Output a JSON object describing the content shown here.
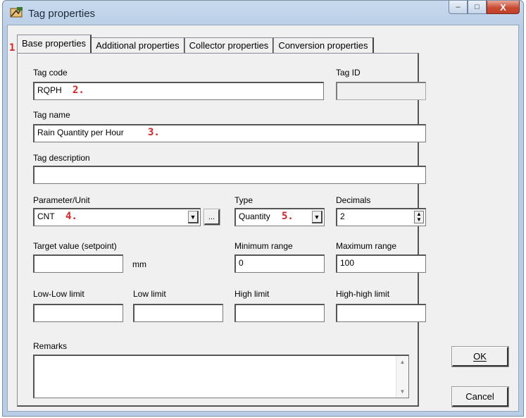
{
  "window": {
    "title": "Tag properties",
    "buttons": {
      "minimize": "–",
      "maximize": "□",
      "close": "X"
    }
  },
  "tabs": [
    {
      "label": "Base properties",
      "active": true
    },
    {
      "label": "Additional properties"
    },
    {
      "label": "Collector properties"
    },
    {
      "label": "Conversion properties"
    }
  ],
  "form": {
    "tag_code": {
      "label": "Tag code",
      "value": "RQPH"
    },
    "tag_id": {
      "label": "Tag ID",
      "value": ""
    },
    "tag_name": {
      "label": "Tag name",
      "value": "Rain Quantity per Hour"
    },
    "tag_description": {
      "label": "Tag description",
      "value": ""
    },
    "parameter_unit": {
      "label": "Parameter/Unit",
      "value": "CNT",
      "browse": "..."
    },
    "type": {
      "label": "Type",
      "value": "Quantity"
    },
    "decimals": {
      "label": "Decimals",
      "value": "2"
    },
    "target_value": {
      "label": "Target value (setpoint)",
      "value": "",
      "unit": "mm"
    },
    "minimum_range": {
      "label": "Minimum range",
      "value": "0"
    },
    "maximum_range": {
      "label": "Maximum range",
      "value": "100"
    },
    "low_low_limit": {
      "label": "Low-Low limit",
      "value": ""
    },
    "low_limit": {
      "label": "Low limit",
      "value": ""
    },
    "high_limit": {
      "label": "High limit",
      "value": ""
    },
    "high_high_limit": {
      "label": "High-high limit",
      "value": ""
    },
    "remarks": {
      "label": "Remarks",
      "value": ""
    }
  },
  "annotations": {
    "a1": "1.",
    "a2": "2.",
    "a3": "3.",
    "a4": "4.",
    "a5": "5."
  },
  "actions": {
    "ok_label": "OK",
    "cancel_label": "Cancel"
  },
  "colors": {
    "annotation": "#e02020",
    "title_bar": "#b8cde6",
    "close_button": "#c94b32"
  },
  "icons": {
    "app": "tag-icon",
    "dropdown": "chevron-down-icon",
    "spin": "spin-updown-icon"
  }
}
